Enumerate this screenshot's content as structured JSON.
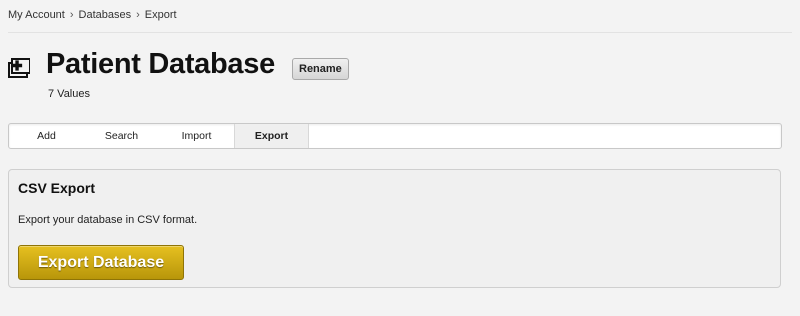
{
  "breadcrumb": {
    "items": [
      "My Account",
      "Databases",
      "Export"
    ],
    "separator": "›"
  },
  "header": {
    "icon": "database-medical-icon",
    "title": "Patient Database",
    "rename_label": "Rename",
    "subtitle": "7 Values"
  },
  "tabs": [
    {
      "label": "Add"
    },
    {
      "label": "Search"
    },
    {
      "label": "Import"
    },
    {
      "label": "Export",
      "active": true
    }
  ],
  "panel": {
    "title": "CSV Export",
    "description": "Export your database in CSV format.",
    "button_label": "Export Database"
  },
  "colors": {
    "accent_button": "#d4ae14",
    "background": "#f3f3f3"
  }
}
